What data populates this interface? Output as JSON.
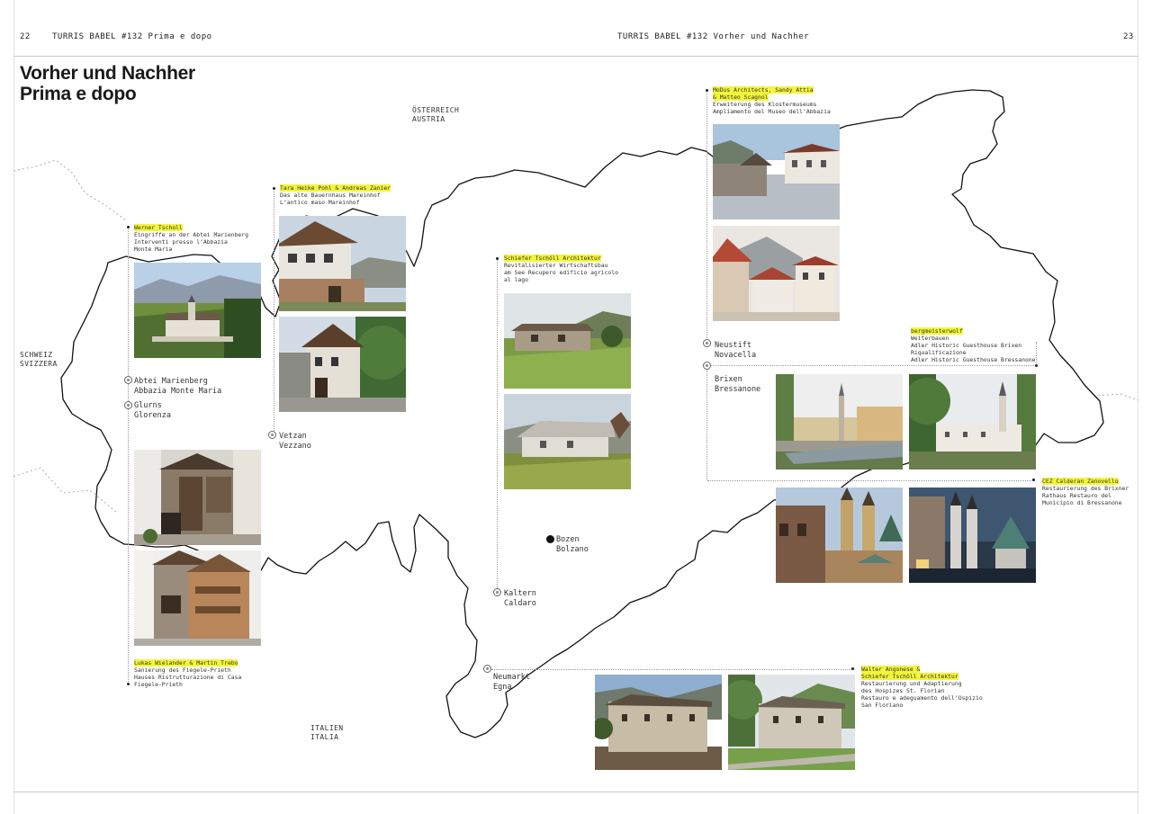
{
  "header": {
    "left_page": "22",
    "left_title": "TURRIS BABEL #132  Prima e dopo",
    "right_title": "TURRIS BABEL #132  Vorher und Nachher",
    "right_page": "23"
  },
  "title": {
    "line1": "Vorher und Nachher",
    "line2": "Prima e dopo"
  },
  "countries": {
    "austria": {
      "line1": "ÖSTERREICH",
      "line2": "AUSTRIA"
    },
    "switzerland": {
      "line1": "SCHWEIZ",
      "line2": "SVIZZERA"
    },
    "italy": {
      "line1": "ITALIEN",
      "line2": "ITALIA"
    }
  },
  "towns": {
    "marienberg": {
      "line1": "Abtei Marienberg",
      "line2": "Abbazia Monte Maria"
    },
    "glurns": {
      "line1": "Glurns",
      "line2": "Glorenza"
    },
    "vetzan": {
      "line1": "Vetzan",
      "line2": "Vezzano"
    },
    "bozen": {
      "line1": "Bozen",
      "line2": "Bolzano"
    },
    "kaltern": {
      "line1": "Kaltern",
      "line2": "Caldaro"
    },
    "neumarkt": {
      "line1": "Neumarkt",
      "line2": "Egna"
    },
    "neustift": {
      "line1": "Neustift",
      "line2": "Novacella"
    },
    "brixen": {
      "line1": "Brixen",
      "line2": "Bressanone"
    }
  },
  "projects": {
    "tscholl": {
      "architect": "Werner Tscholl",
      "line1": "Eingriffe an der Abtei Marienberg",
      "line2": "Interventi presso l’Abbazia",
      "line3": "Monte Maria"
    },
    "pohl": {
      "architect": "Tara Heike Pohl & Andreas Zanier",
      "line1": "Das alte Bauernhaus Mareinhof",
      "line2": "L’antico maso Mareinhof"
    },
    "wielander": {
      "architect": "Lukas Wielander & Martin Trebo",
      "line1": "Sanierung des Fiegele-Prieth",
      "line2": "Hauses  Ristrutturazione di Casa",
      "line3": "Fiegele-Prieth"
    },
    "schiefer": {
      "architect": "Schiefer Tschöll Architektur",
      "line1": "Revitalisierter Wirtschaftsbau",
      "line2": "am See  Recupero edificio agricolo",
      "line3": "al lago"
    },
    "modus": {
      "architect1": "MoDus Architects, Sandy Attia",
      "architect2": "& Matteo Scagnol",
      "line1": "Erweiterung des Klostermuseums",
      "line2": "Ampliamento del Museo dell’Abbazia"
    },
    "bergmeister": {
      "architect": "bergmeisterwolf",
      "line1": "Weiterbauen",
      "line2": "Adler Historic Guesthouse Brixen",
      "line3": "Riqualificazione",
      "line4": "Adler Historic Guesthouse Bressanone"
    },
    "cez": {
      "architect": "CEZ Calderan Zanovello",
      "line1": "Restaurierung des Brixner",
      "line2": "Rathaus  Restauro del",
      "line3": "Municipio di Bressanone"
    },
    "angonese": {
      "architect1": "Walter Angonese &",
      "architect2": "Schiefer Tschöll Architektur",
      "line1": "Restaurierung und Adaptierung",
      "line2": "des Hospizes St. Florian",
      "line3": "Restauro e adeguamento dell’Ospizio",
      "line4": "San Floriano"
    }
  },
  "colors": {
    "highlight": "#f2f53a",
    "border": "#111111",
    "leader": "#9a9a9a"
  }
}
